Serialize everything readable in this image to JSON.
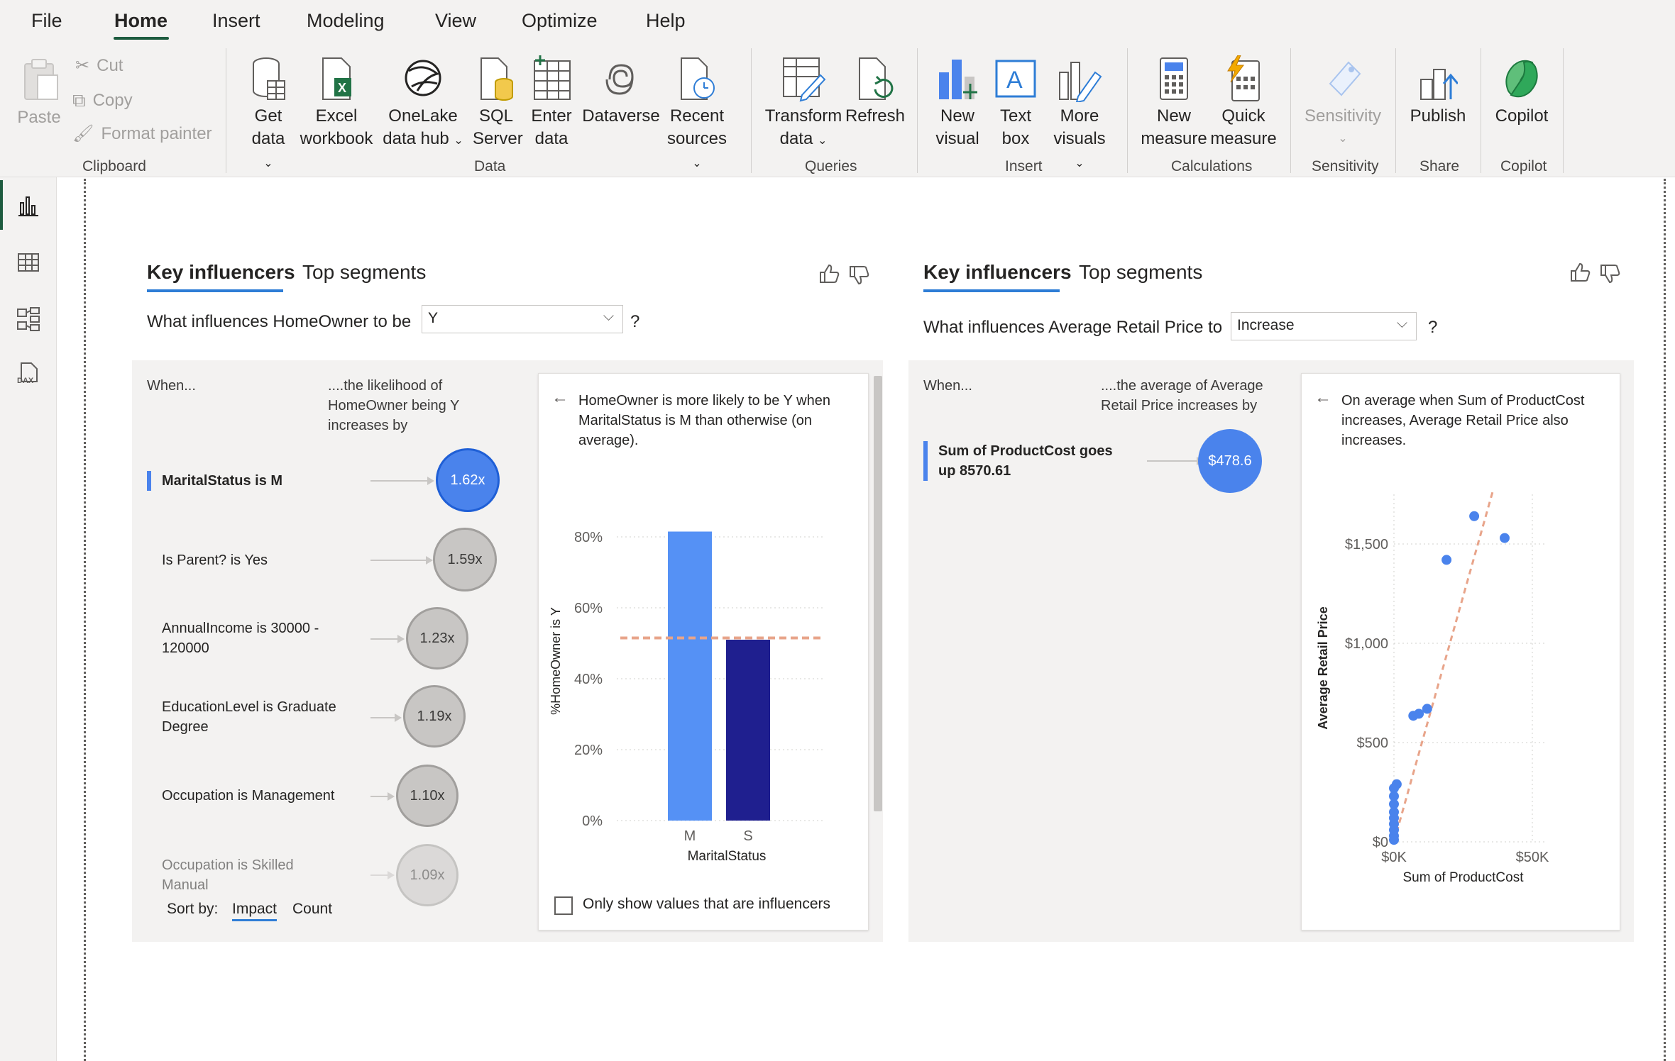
{
  "menu": {
    "items": [
      "File",
      "Home",
      "Insert",
      "Modeling",
      "View",
      "Optimize",
      "Help"
    ],
    "active": "Home"
  },
  "ribbon": {
    "clipboard": {
      "paste": "Paste",
      "cut": "Cut",
      "copy": "Copy",
      "format_painter": "Format painter",
      "group": "Clipboard"
    },
    "data": {
      "get_data": [
        "Get",
        "data"
      ],
      "excel": [
        "Excel",
        "workbook"
      ],
      "onelake": [
        "OneLake",
        "data hub"
      ],
      "sql": [
        "SQL",
        "Server"
      ],
      "enter": [
        "Enter",
        "data"
      ],
      "dataverse": "Dataverse",
      "recent": [
        "Recent",
        "sources"
      ],
      "group": "Data"
    },
    "queries": {
      "transform": [
        "Transform",
        "data"
      ],
      "refresh": "Refresh",
      "group": "Queries"
    },
    "insert": {
      "new_visual": [
        "New",
        "visual"
      ],
      "text_box": [
        "Text",
        "box"
      ],
      "more_visuals": [
        "More",
        "visuals"
      ],
      "group": "Insert"
    },
    "calculations": {
      "new_measure": [
        "New",
        "measure"
      ],
      "quick_measure": [
        "Quick",
        "measure"
      ],
      "group": "Calculations"
    },
    "sensitivity": {
      "label": "Sensitivity",
      "group": "Sensitivity"
    },
    "share": {
      "publish": "Publish",
      "group": "Share"
    },
    "copilot": {
      "copilot": "Copilot",
      "group": "Copilot"
    }
  },
  "left_visual": {
    "tabs": [
      "Key influencers",
      "Top segments"
    ],
    "question_prefix": "What influences HomeOwner to be",
    "dropdown_value": "Y",
    "question_mark": "?",
    "col_when": "When...",
    "col_likelihood": [
      "....the likelihood of",
      "HomeOwner being Y",
      "increases by"
    ],
    "influencers": [
      {
        "label": [
          "MaritalStatus is M"
        ],
        "value": "1.62x",
        "selected": true
      },
      {
        "label": [
          "Is Parent? is Yes"
        ],
        "value": "1.59x",
        "selected": false
      },
      {
        "label": [
          "AnnualIncome is 30000 -",
          "120000"
        ],
        "value": "1.23x",
        "selected": false
      },
      {
        "label": [
          "EducationLevel is Graduate",
          "Degree"
        ],
        "value": "1.19x",
        "selected": false
      },
      {
        "label": [
          "Occupation is Management"
        ],
        "value": "1.10x",
        "selected": false
      },
      {
        "label": [
          "Occupation is Skilled",
          "Manual"
        ],
        "value": "1.09x",
        "selected": false
      }
    ],
    "sort_by": "Sort by:",
    "sort_impact": "Impact",
    "sort_count": "Count",
    "detail_text": [
      "HomeOwner is more likely to be Y when",
      "MaritalStatus is M than otherwise (on",
      "average)."
    ],
    "only_influencers": "Only show values that are influencers"
  },
  "right_visual": {
    "tabs": [
      "Key influencers",
      "Top segments"
    ],
    "question_prefix": "What influences Average Retail Price to",
    "dropdown_value": "Increase",
    "question_mark": "?",
    "col_when": "When...",
    "col_avg": [
      "....the average of Average",
      "Retail Price increases by"
    ],
    "influencer": {
      "label": [
        "Sum of ProductCost goes",
        "up 8570.61"
      ],
      "value": "$478.6"
    },
    "detail_text": [
      "On average when Sum of ProductCost",
      "increases, Average Retail Price also",
      "increases."
    ]
  },
  "chart_data": [
    {
      "type": "bar",
      "categories": [
        "M",
        "S"
      ],
      "values": [
        81.5,
        51
      ],
      "reference_line": 51.5,
      "xlabel": "MaritalStatus",
      "ylabel": "%HomeOwner is Y",
      "yticks": [
        "0%",
        "20%",
        "40%",
        "60%",
        "80%"
      ],
      "ylim": [
        0,
        90
      ],
      "colors": [
        "#5591f5",
        "#1f1f8f"
      ],
      "reference_color": "#e8a48a"
    },
    {
      "type": "scatter",
      "x": [
        0,
        0,
        0,
        0,
        0,
        0,
        0,
        0,
        0,
        1,
        7,
        9,
        12,
        19,
        29,
        40
      ],
      "y": [
        10,
        30,
        60,
        90,
        120,
        150,
        190,
        230,
        270,
        290,
        635,
        645,
        670,
        1420,
        1640,
        1530
      ],
      "xlabel": "Sum of ProductCost",
      "ylabel": "Average Retail Price",
      "xticks": [
        "$0K",
        "$50K"
      ],
      "yticks": [
        "$0",
        "$500",
        "$1,000",
        "$1,500"
      ],
      "xlim": [
        0,
        50
      ],
      "ylim": [
        0,
        1750
      ],
      "trend": [
        [
          0,
          0
        ],
        [
          36,
          1780
        ]
      ],
      "point_color": "#4a83ec",
      "trend_color": "#e8a48a"
    }
  ]
}
